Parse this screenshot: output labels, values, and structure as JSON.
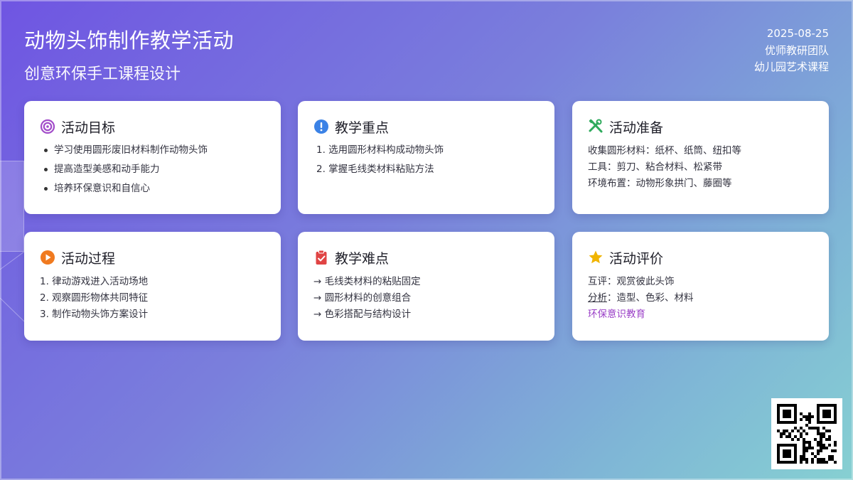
{
  "header": {
    "title": "动物头饰制作教学活动",
    "subtitle": "创意环保手工课程设计",
    "date": "2025-08-25",
    "team": "优师教研团队",
    "course": "幼儿园艺术课程"
  },
  "cards": {
    "goals": {
      "title": "活动目标",
      "icon": "target-icon",
      "color": "#a24cc9",
      "items": [
        "学习使用圆形废旧材料制作动物头饰",
        "提高造型美感和动手能力",
        "培养环保意识和自信心"
      ]
    },
    "focus": {
      "title": "教学重点",
      "icon": "exclamation-icon",
      "color": "#3b82e6",
      "items": [
        "1. 选用圆形材料构成动物头饰",
        "2. 掌握毛线类材料粘贴方法"
      ]
    },
    "prep": {
      "title": "活动准备",
      "icon": "tools-icon",
      "color": "#2eaa5c",
      "items": [
        "收集圆形材料：纸杯、纸筒、纽扣等",
        "工具：剪刀、粘合材料、松紧带",
        "环境布置：动物形象拱门、藤圈等"
      ]
    },
    "process": {
      "title": "活动过程",
      "icon": "play-icon",
      "color": "#f07a1f",
      "items": [
        "1. 律动游戏进入活动场地",
        "2. 观察圆形物体共同特征",
        "3. 制作动物头饰方案设计"
      ]
    },
    "difficulty": {
      "title": "教学难点",
      "icon": "clipboard-check-icon",
      "color": "#e04444",
      "items": [
        "→ 毛线类材料的粘贴固定",
        "→ 圆形材料的创意组合",
        "→ 色彩搭配与结构设计"
      ]
    },
    "evaluation": {
      "title": "活动评价",
      "icon": "star-icon",
      "color": "#f0b400",
      "line1": "互评：观赏彼此头饰",
      "line2_label": "分析",
      "line2_rest": "：造型、色彩、材料",
      "line3": "环保意识教育",
      "line3_color": "#9a3fc7"
    }
  },
  "qr": {
    "icon": "qr-code-icon"
  }
}
